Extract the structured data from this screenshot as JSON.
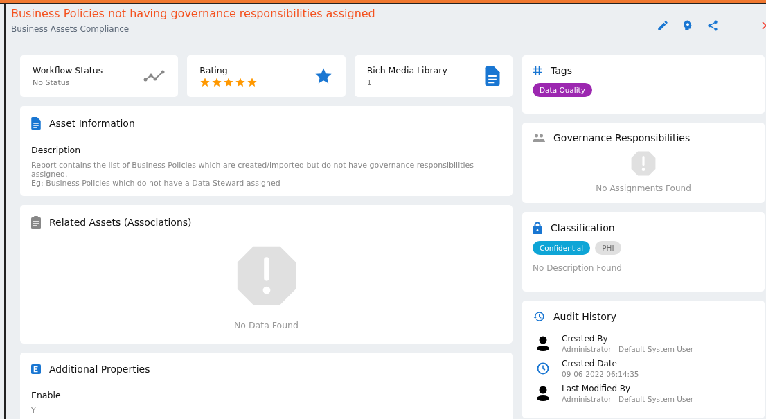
{
  "header": {
    "title": "Business Policies not having governance responsibilities assigned",
    "subtitle": "Business Assets Compliance"
  },
  "stats": [
    {
      "kind": "status",
      "label": "Workflow Status",
      "value": "No Status"
    },
    {
      "kind": "rating",
      "label": "Rating",
      "stars": 5
    },
    {
      "kind": "media",
      "label": "Rich Media Library",
      "value": "1"
    }
  ],
  "asset_information": {
    "title": "Asset Information",
    "field_label": "Description",
    "lines": [
      "Report contains the list of Business Policies which are created/imported but do not have governance responsibilities assigned.",
      "Eg: Business Policies which do not have a Data Steward assigned"
    ]
  },
  "related_assets": {
    "title": "Related Assets (Associations)",
    "empty_text": "No Data Found"
  },
  "additional_properties": {
    "title": "Additional Properties",
    "field_label": "Enable",
    "value": "Y"
  },
  "tags": {
    "title": "Tags",
    "items": [
      {
        "label": "Data Quality",
        "color": "#9c27b0"
      }
    ]
  },
  "governance": {
    "title": "Governance Responsibilities",
    "empty_text": "No Assignments Found"
  },
  "classification": {
    "title": "Classification",
    "items": [
      {
        "label": "Confidential",
        "color": "#0ea5d6"
      },
      {
        "label": "PHI",
        "color": "#e0e0e0"
      }
    ],
    "empty_text": "No Description Found"
  },
  "audit_history": {
    "title": "Audit History",
    "entries": [
      {
        "kind": "user",
        "label": "Created By",
        "value": "Administrator - Default System User"
      },
      {
        "kind": "date",
        "label": "Created Date",
        "value": "09-06-2022 06:14:35"
      },
      {
        "kind": "user",
        "label": "Last Modified By",
        "value": "Administrator - Default System User"
      }
    ]
  }
}
